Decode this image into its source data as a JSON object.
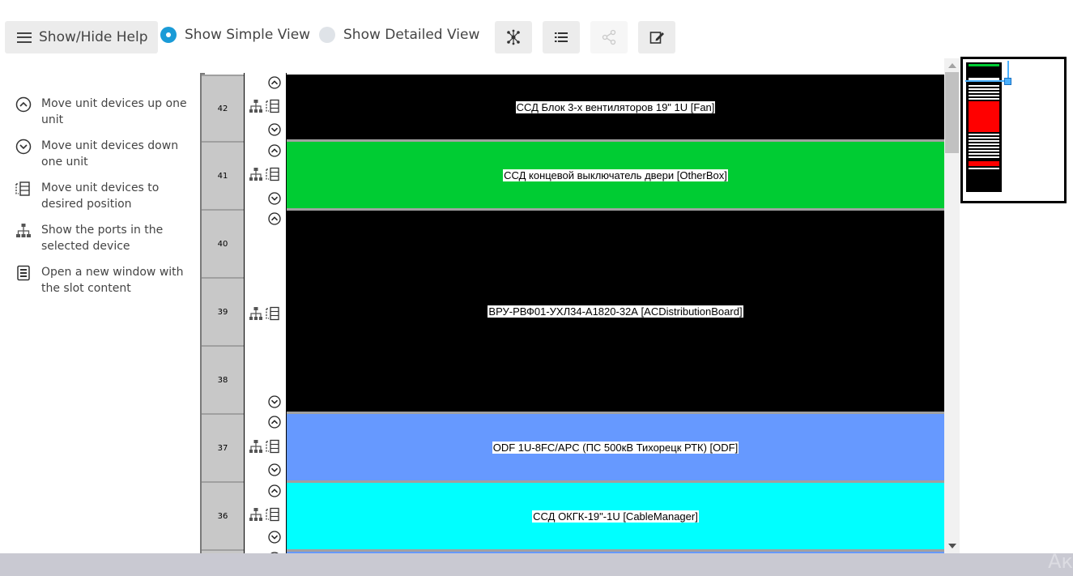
{
  "toolbar": {
    "help_label": "Show/Hide Help",
    "simple_view_label": "Show Simple View",
    "detailed_view_label": "Show Detailed View",
    "selected_view": "simple",
    "icon_buttons": [
      "network-icon",
      "list-icon",
      "share-icon",
      "edit-icon"
    ],
    "accent_color": "#1a9bd7"
  },
  "help": {
    "items": [
      {
        "icon": "chevron-up-circle-icon",
        "text": "Move unit devices up one unit"
      },
      {
        "icon": "chevron-down-circle-icon",
        "text": "Move unit devices down one unit"
      },
      {
        "icon": "move-to-position-icon",
        "text": "Move unit devices to desired position"
      },
      {
        "icon": "ports-hierarchy-icon",
        "text": "Show the ports in the selected device"
      },
      {
        "icon": "open-window-icon",
        "text": "Open a new window with the slot content"
      }
    ]
  },
  "rack": {
    "units": [
      "42",
      "41",
      "40",
      "39",
      "38",
      "37",
      "36"
    ],
    "devices": [
      {
        "label": "ССД Блок 3-х вентиляторов 19\" 1U [Fan]",
        "units": [
          "42"
        ],
        "color": "#000000"
      },
      {
        "label": "ССД концевой выключатель двери [OtherBox]",
        "units": [
          "41"
        ],
        "color": "#00cc33"
      },
      {
        "label": "ВРУ-РВФ01-УХЛ34-А1820-32А [ACDistributionBoard]",
        "units": [
          "40",
          "39",
          "38"
        ],
        "color": "#000000"
      },
      {
        "label": "ODF 1U-8FC/APC (ПС 500кВ Тихорецк РТК) [ODF]",
        "units": [
          "37"
        ],
        "color": "#6699ff"
      },
      {
        "label": "ССД ОКГК-19\"-1U [CableManager]",
        "units": [
          "36"
        ],
        "color": "#00ffff"
      }
    ]
  },
  "minimap": {
    "blocks_colors": [
      "#00cc33",
      "#000000",
      "#ffffff",
      "#ff0000"
    ],
    "viewport_color": "#4ab1ff"
  },
  "footer": {
    "watermark": "Ак"
  }
}
